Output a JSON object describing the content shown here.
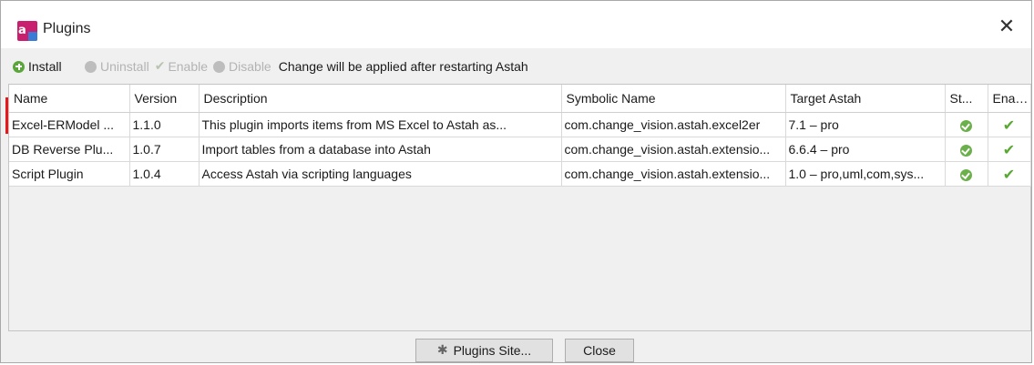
{
  "window": {
    "title": "Plugins",
    "close_glyph": "✕"
  },
  "toolbar": {
    "install_label": "Install",
    "uninstall_label": "Uninstall",
    "enable_label": "Enable",
    "disable_label": "Disable",
    "notice": "Change will be applied after restarting Astah"
  },
  "table": {
    "columns": [
      "Name",
      "Version",
      "Description",
      "Symbolic Name",
      "Target Astah",
      "St...",
      "Enab..."
    ],
    "rows": [
      {
        "name": "Excel-ERModel ...",
        "version": "1.1.0",
        "description": "This plugin imports items from MS Excel to Astah as...",
        "symbolic_name": "com.change_vision.astah.excel2er",
        "target": "7.1 – pro",
        "status": "active",
        "enabled": true
      },
      {
        "name": "DB Reverse Plu...",
        "version": "1.0.7",
        "description": "Import tables from a database into Astah",
        "symbolic_name": "com.change_vision.astah.extensio...",
        "target": "6.6.4 – pro",
        "status": "active",
        "enabled": true
      },
      {
        "name": "Script Plugin",
        "version": "1.0.4",
        "description": "Access Astah via scripting languages",
        "symbolic_name": "com.change_vision.astah.extensio...",
        "target": "1.0 – pro,uml,com,sys...",
        "status": "active",
        "enabled": true
      }
    ]
  },
  "buttons": {
    "plugins_site": "Plugins Site...",
    "close": "Close"
  },
  "colors": {
    "highlight": "#e8161b",
    "status_green": "#6bb04a"
  }
}
